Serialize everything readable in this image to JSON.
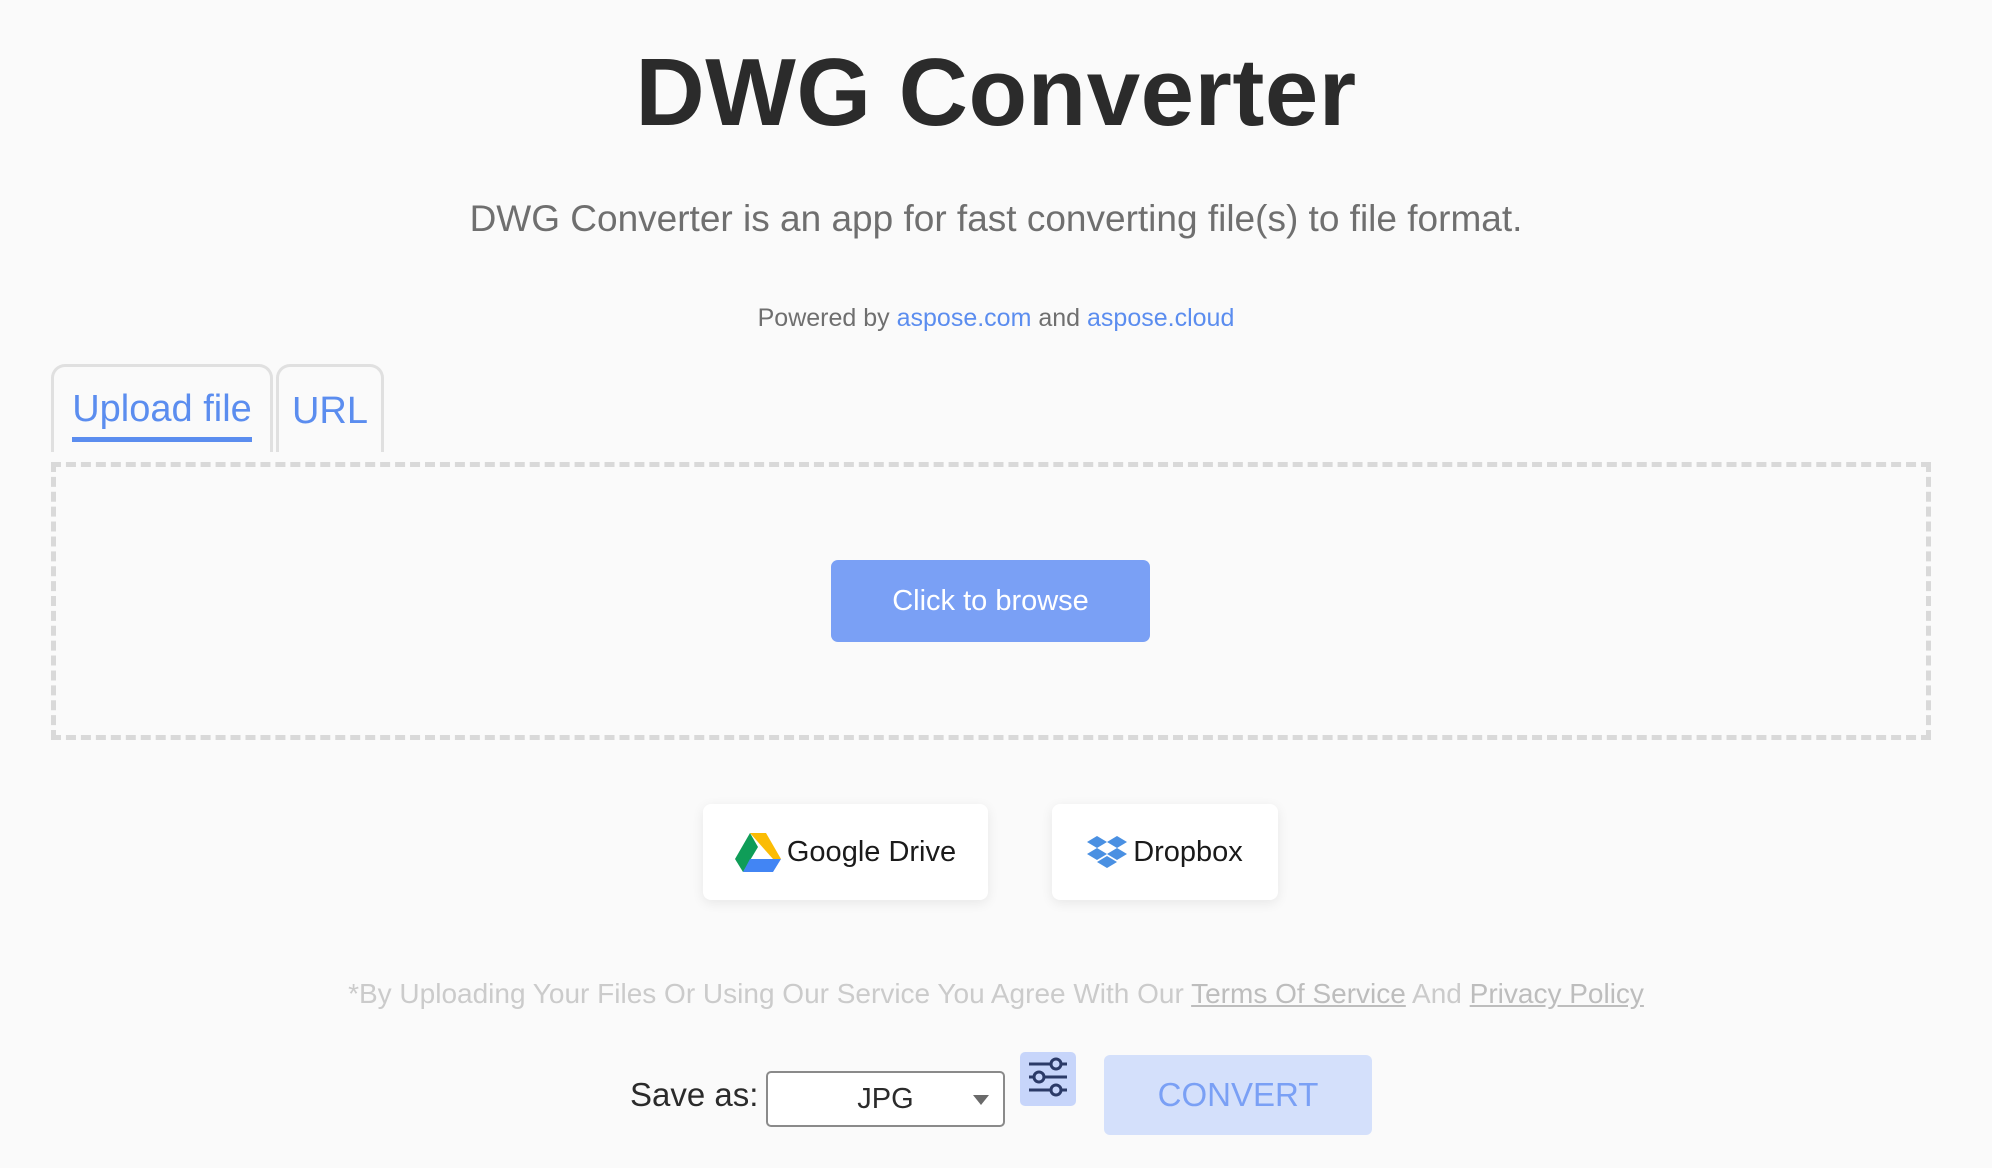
{
  "header": {
    "title": "DWG Converter",
    "subtitle": "DWG Converter is an app for fast converting file(s) to file format.",
    "powered_prefix": "Powered by",
    "powered_link1": "aspose.com",
    "powered_and": "and",
    "powered_link2": "aspose.cloud"
  },
  "tabs": [
    {
      "label": "Upload file",
      "active": true
    },
    {
      "label": "URL",
      "active": false
    }
  ],
  "upload": {
    "browse_label": "Click to browse"
  },
  "cloud": {
    "google_drive_label": "Google Drive",
    "dropbox_label": "Dropbox"
  },
  "terms": {
    "prefix": "*By Uploading Your Files Or Using Our Service You Agree With Our",
    "tos_link": "Terms Of Service",
    "and": "And",
    "privacy_link": "Privacy Policy"
  },
  "convert": {
    "save_as_label": "Save as:",
    "selected_format": "JPG",
    "button_label": "CONVERT"
  },
  "colors": {
    "accent": "#5b8def",
    "button_primary": "#7aa0f5",
    "button_disabled_bg": "#d4e0fb",
    "background": "#fafafa"
  },
  "icons": {
    "google_drive": "google-drive-icon",
    "dropbox": "dropbox-icon",
    "settings": "sliders-icon",
    "dropdown": "chevron-down-icon"
  }
}
